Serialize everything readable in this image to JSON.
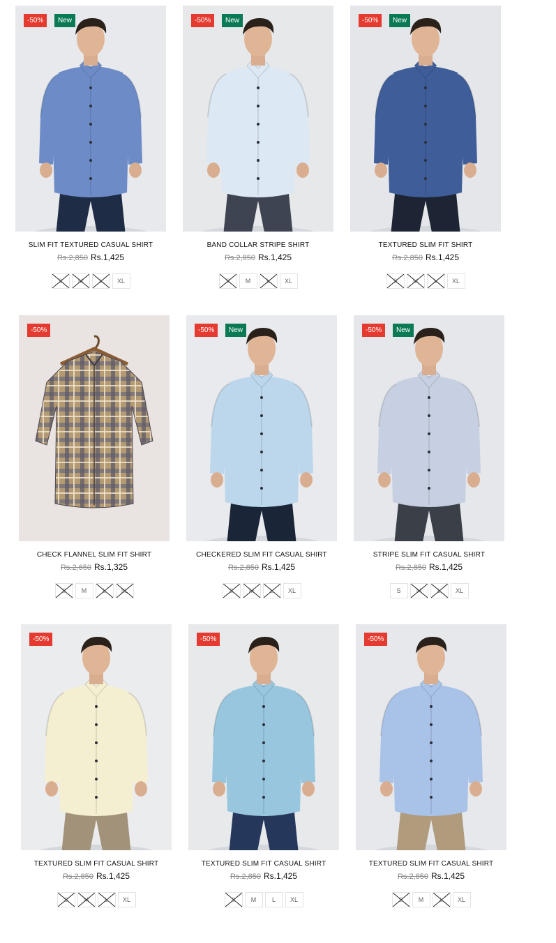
{
  "products": [
    {
      "title": "SLIM FIT TEXTURED CASUAL SHIRT",
      "old_price": "Rs.2,850",
      "price": "Rs.1,425",
      "discount": "-50%",
      "new": "New",
      "shirt_color": "#6d8cc7",
      "pants_color": "#1f2c45",
      "bg_color": "#e7e9ec",
      "sizes": [
        {
          "label": "S",
          "available": false
        },
        {
          "label": "M",
          "available": false
        },
        {
          "label": "L",
          "available": false
        },
        {
          "label": "XL",
          "available": true
        }
      ]
    },
    {
      "title": "BAND COLLAR STRIPE SHIRT",
      "old_price": "Rs.2,850",
      "price": "Rs.1,425",
      "discount": "-50%",
      "new": "New",
      "shirt_color": "#dce8f3",
      "pants_color": "#3f4452",
      "bg_color": "#e6e8ea",
      "sizes": [
        {
          "label": "S",
          "available": false
        },
        {
          "label": "M",
          "available": true
        },
        {
          "label": "L",
          "available": false
        },
        {
          "label": "XL",
          "available": true
        }
      ]
    },
    {
      "title": "TEXTURED SLIM FIT SHIRT",
      "old_price": "Rs.2,850",
      "price": "Rs.1,425",
      "discount": "-50%",
      "new": "New",
      "shirt_color": "#3e5d99",
      "pants_color": "#1d2433",
      "bg_color": "#e4e6e9",
      "sizes": [
        {
          "label": "S",
          "available": false
        },
        {
          "label": "M",
          "available": false
        },
        {
          "label": "L",
          "available": false
        },
        {
          "label": "XL",
          "available": true
        }
      ]
    },
    {
      "title": "CHECK FLANNEL SLIM FIT SHIRT",
      "old_price": "Rs.2,650",
      "price": "Rs.1,325",
      "discount": "-50%",
      "new": "",
      "shirt_color": "#b39a72",
      "pants_color": "",
      "bg_color": "#e9e4e2",
      "sizes": [
        {
          "label": "S",
          "available": false
        },
        {
          "label": "M",
          "available": true
        },
        {
          "label": "L",
          "available": false
        },
        {
          "label": "XL",
          "available": false
        }
      ]
    },
    {
      "title": "CHECKERED SLIM FIT CASUAL SHIRT",
      "old_price": "Rs.2,850",
      "price": "Rs.1,425",
      "discount": "-50%",
      "new": "New",
      "shirt_color": "#bcd7ec",
      "pants_color": "#1b2538",
      "bg_color": "#e8eaed",
      "sizes": [
        {
          "label": "S",
          "available": false
        },
        {
          "label": "M",
          "available": false
        },
        {
          "label": "L",
          "available": false
        },
        {
          "label": "XL",
          "available": true
        }
      ]
    },
    {
      "title": "STRIPE SLIM FIT CASUAL SHIRT",
      "old_price": "Rs.2,850",
      "price": "Rs.1,425",
      "discount": "-50%",
      "new": "New",
      "shirt_color": "#c7d0e2",
      "pants_color": "#3a3f48",
      "bg_color": "#e5e7ea",
      "sizes": [
        {
          "label": "S",
          "available": true
        },
        {
          "label": "M",
          "available": false
        },
        {
          "label": "L",
          "available": false
        },
        {
          "label": "XL",
          "available": true
        }
      ]
    },
    {
      "title": "TEXTURED SLIM FIT CASUAL SHIRT",
      "old_price": "Rs.2,850",
      "price": "Rs.1,425",
      "discount": "-50%",
      "new": "",
      "shirt_color": "#f5efd2",
      "pants_color": "#a3927a",
      "bg_color": "#eaecee",
      "sizes": [
        {
          "label": "S",
          "available": false
        },
        {
          "label": "M",
          "available": false
        },
        {
          "label": "L",
          "available": false
        },
        {
          "label": "XL",
          "available": true
        }
      ]
    },
    {
      "title": "TEXTURED SLIM FIT CASUAL SHIRT",
      "old_price": "Rs.2,850",
      "price": "Rs.1,425",
      "discount": "-50%",
      "new": "",
      "shirt_color": "#98c6df",
      "pants_color": "#26375c",
      "bg_color": "#e7e9eb",
      "sizes": [
        {
          "label": "S",
          "available": false
        },
        {
          "label": "M",
          "available": true
        },
        {
          "label": "L",
          "available": true
        },
        {
          "label": "XL",
          "available": true
        }
      ]
    },
    {
      "title": "TEXTURED SLIM FIT CASUAL SHIRT",
      "old_price": "Rs.2,850",
      "price": "Rs.1,425",
      "discount": "-50%",
      "new": "",
      "shirt_color": "#a9c2e8",
      "pants_color": "#b09c7c",
      "bg_color": "#e6e8eb",
      "sizes": [
        {
          "label": "S",
          "available": false
        },
        {
          "label": "M",
          "available": true
        },
        {
          "label": "L",
          "available": false
        },
        {
          "label": "XL",
          "available": true
        }
      ]
    }
  ]
}
